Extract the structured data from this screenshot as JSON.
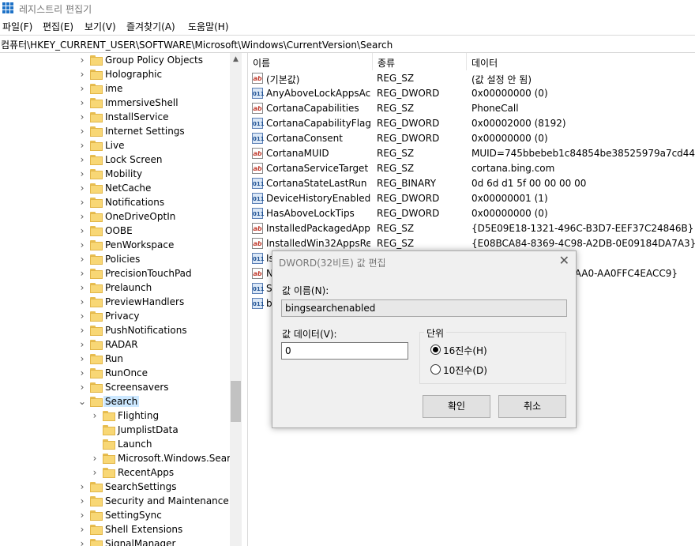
{
  "window": {
    "title": "레지스트리 편집기",
    "menu": [
      "파일(F)",
      "편집(E)",
      "보기(V)",
      "즐겨찾기(A)",
      "도움말(H)"
    ],
    "address": "컴퓨터\\HKEY_CURRENT_USER\\SOFTWARE\\Microsoft\\Windows\\CurrentVersion\\Search"
  },
  "tree": {
    "items": [
      {
        "label": "Group Policy Objects",
        "depth": 0,
        "expander": "›"
      },
      {
        "label": "Holographic",
        "depth": 0,
        "expander": "›"
      },
      {
        "label": "ime",
        "depth": 0,
        "expander": "›"
      },
      {
        "label": "ImmersiveShell",
        "depth": 0,
        "expander": "›"
      },
      {
        "label": "InstallService",
        "depth": 0,
        "expander": "›"
      },
      {
        "label": "Internet Settings",
        "depth": 0,
        "expander": "›"
      },
      {
        "label": "Live",
        "depth": 0,
        "expander": "›"
      },
      {
        "label": "Lock Screen",
        "depth": 0,
        "expander": "›"
      },
      {
        "label": "Mobility",
        "depth": 0,
        "expander": "›"
      },
      {
        "label": "NetCache",
        "depth": 0,
        "expander": "›"
      },
      {
        "label": "Notifications",
        "depth": 0,
        "expander": "›"
      },
      {
        "label": "OneDriveOptIn",
        "depth": 0,
        "expander": "›"
      },
      {
        "label": "OOBE",
        "depth": 0,
        "expander": "›"
      },
      {
        "label": "PenWorkspace",
        "depth": 0,
        "expander": "›"
      },
      {
        "label": "Policies",
        "depth": 0,
        "expander": "›"
      },
      {
        "label": "PrecisionTouchPad",
        "depth": 0,
        "expander": "›"
      },
      {
        "label": "Prelaunch",
        "depth": 0,
        "expander": "›"
      },
      {
        "label": "PreviewHandlers",
        "depth": 0,
        "expander": "›"
      },
      {
        "label": "Privacy",
        "depth": 0,
        "expander": "›"
      },
      {
        "label": "PushNotifications",
        "depth": 0,
        "expander": "›"
      },
      {
        "label": "RADAR",
        "depth": 0,
        "expander": "›"
      },
      {
        "label": "Run",
        "depth": 0,
        "expander": "›"
      },
      {
        "label": "RunOnce",
        "depth": 0,
        "expander": "›"
      },
      {
        "label": "Screensavers",
        "depth": 0,
        "expander": "›"
      },
      {
        "label": "Search",
        "depth": 0,
        "expander": "⌄",
        "selected": true
      },
      {
        "label": "Flighting",
        "depth": 1,
        "expander": "›"
      },
      {
        "label": "JumplistData",
        "depth": 1,
        "expander": ""
      },
      {
        "label": "Launch",
        "depth": 1,
        "expander": ""
      },
      {
        "label": "Microsoft.Windows.Search",
        "depth": 1,
        "expander": "›"
      },
      {
        "label": "RecentApps",
        "depth": 1,
        "expander": "›"
      },
      {
        "label": "SearchSettings",
        "depth": 0,
        "expander": "›"
      },
      {
        "label": "Security and Maintenance",
        "depth": 0,
        "expander": "›"
      },
      {
        "label": "SettingSync",
        "depth": 0,
        "expander": "›"
      },
      {
        "label": "Shell Extensions",
        "depth": 0,
        "expander": "›"
      },
      {
        "label": "SignalManager",
        "depth": 0,
        "expander": "›"
      }
    ]
  },
  "list": {
    "columns": [
      "이름",
      "종류",
      "데이터"
    ],
    "rows": [
      {
        "icon": "sz",
        "name": "(기본값)",
        "type": "REG_SZ",
        "data": "(값 설정 안 됨)"
      },
      {
        "icon": "bin",
        "name": "AnyAboveLockAppsAc...",
        "type": "REG_DWORD",
        "data": "0x00000000 (0)"
      },
      {
        "icon": "sz",
        "name": "CortanaCapabilities",
        "type": "REG_SZ",
        "data": "PhoneCall"
      },
      {
        "icon": "bin",
        "name": "CortanaCapabilityFlags",
        "type": "REG_DWORD",
        "data": "0x00002000 (8192)"
      },
      {
        "icon": "bin",
        "name": "CortanaConsent",
        "type": "REG_DWORD",
        "data": "0x00000000 (0)"
      },
      {
        "icon": "sz",
        "name": "CortanaMUID",
        "type": "REG_SZ",
        "data": "MUID=745bbebeb1c84854be38525979a7cd44"
      },
      {
        "icon": "sz",
        "name": "CortanaServiceTarget",
        "type": "REG_SZ",
        "data": "cortana.bing.com"
      },
      {
        "icon": "bin",
        "name": "CortanaStateLastRun",
        "type": "REG_BINARY",
        "data": "0d 6d d1 5f 00 00 00 00"
      },
      {
        "icon": "bin",
        "name": "DeviceHistoryEnabled",
        "type": "REG_DWORD",
        "data": "0x00000001 (1)"
      },
      {
        "icon": "bin",
        "name": "HasAboveLockTips",
        "type": "REG_DWORD",
        "data": "0x00000000 (0)"
      },
      {
        "icon": "sz",
        "name": "InstalledPackagedApps...",
        "type": "REG_SZ",
        "data": "{D5E09E18-1321-496C-B3D7-EEF37C24846B}"
      },
      {
        "icon": "sz",
        "name": "InstalledWin32AppsRe...",
        "type": "REG_SZ",
        "data": "{E08BCA84-8369-4C98-A2DB-0E09184DA7A3}"
      },
      {
        "icon": "bin",
        "name": "Is",
        "type": "",
        "data": ""
      },
      {
        "icon": "sz",
        "name": "N",
        "type": "",
        "data": "AAA0-AA0FFC4EACC9}"
      },
      {
        "icon": "bin",
        "name": "Se",
        "type": "",
        "data": ""
      },
      {
        "icon": "bin",
        "name": "b",
        "type": "",
        "data": ""
      }
    ]
  },
  "dialog": {
    "title": "DWORD(32비트) 값 편집",
    "close_glyph": "✕",
    "name_label": "값 이름(N):",
    "name_value": "bingsearchenabled",
    "data_label": "값 데이터(V):",
    "data_value": "0",
    "base_group_label": "단위",
    "radio_hex": "16진수(H)",
    "radio_dec": "10진수(D)",
    "selected_base": "hex",
    "ok_label": "확인",
    "cancel_label": "취소"
  }
}
